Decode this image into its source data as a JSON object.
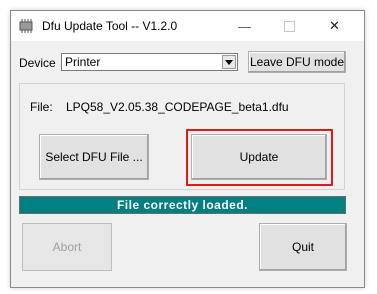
{
  "window": {
    "title": "Dfu Update Tool -- V1.2.0",
    "icon": "app-chip-icon",
    "controls": {
      "minimize": "—",
      "close": "✕"
    }
  },
  "device": {
    "label": "Device",
    "selected": "Printer"
  },
  "buttons": {
    "leave_dfu": "Leave DFU mode",
    "select_file": "Select DFU File ...",
    "update": "Update",
    "abort": "Abort",
    "quit": "Quit"
  },
  "file": {
    "label": "File:",
    "name": "LPQ58_V2.05.38_CODEPAGE_beta1.dfu"
  },
  "status": {
    "text": "File correctly loaded.",
    "color": "#008080"
  },
  "highlight": {
    "color": "#e01919"
  }
}
